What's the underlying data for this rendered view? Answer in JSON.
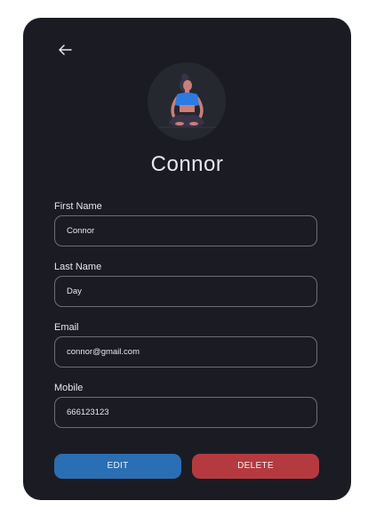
{
  "profile": {
    "name": "Connor",
    "avatar_icon": "meditating-person-illustration"
  },
  "nav": {
    "back_icon": "arrow-left-icon"
  },
  "form": {
    "fields": [
      {
        "label": "First Name",
        "value": "Connor"
      },
      {
        "label": "Last Name",
        "value": "Day"
      },
      {
        "label": "Email",
        "value": "connor@gmail.com"
      },
      {
        "label": "Mobile",
        "value": "666123123"
      }
    ]
  },
  "actions": {
    "edit_label": "EDIT",
    "delete_label": "DELETE"
  },
  "colors": {
    "card_background": "#1b1c23",
    "edit_button": "#2a6eb3",
    "delete_button": "#b53a3f",
    "field_border": "#6b6e78",
    "text": "#e6e7ec"
  }
}
